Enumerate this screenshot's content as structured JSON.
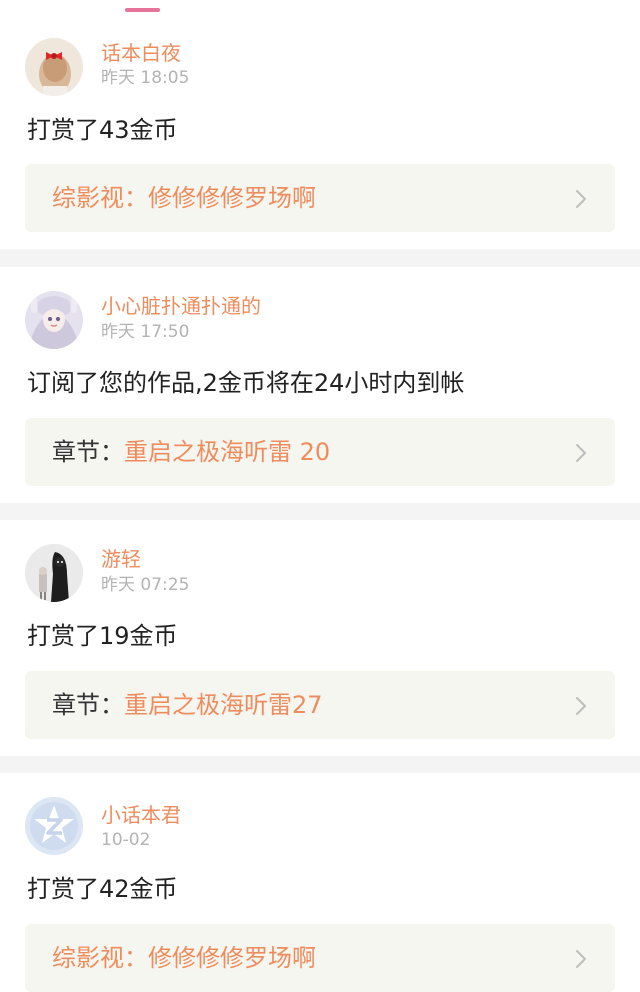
{
  "theme": {
    "accent": "#ef8c5e",
    "tab_indicator": "#e5739a",
    "label_dark": "#333333",
    "chevron": "#bdbdbd"
  },
  "notifications": [
    {
      "username": "话本白夜",
      "time": "昨天 18:05",
      "message": "打赏了43金币",
      "work_label": "综影视：",
      "work_title": "修修修修罗场啊",
      "label_style": "accent",
      "avatar": "girl-with-red-bow-avatar"
    },
    {
      "username": "小心脏扑通扑通的",
      "time": "昨天 17:50",
      "message": "订阅了您的作品,2金币将在24小时内到帐",
      "work_label": "章节：",
      "work_title": "重启之极海听雷 20",
      "label_style": "dark",
      "avatar": "anime-girl-avatar"
    },
    {
      "username": "游轻",
      "time": "昨天 07:25",
      "message": "打赏了19金币",
      "work_label": "章节：",
      "work_title": "重启之极海听雷27",
      "label_style": "dark",
      "avatar": "dark-figure-avatar"
    },
    {
      "username": "小话本君",
      "time": "10-02",
      "message": "打赏了42金币",
      "work_label": "综影视：",
      "work_title": "修修修修罗场啊",
      "label_style": "accent",
      "avatar": "z-logo-avatar"
    }
  ]
}
